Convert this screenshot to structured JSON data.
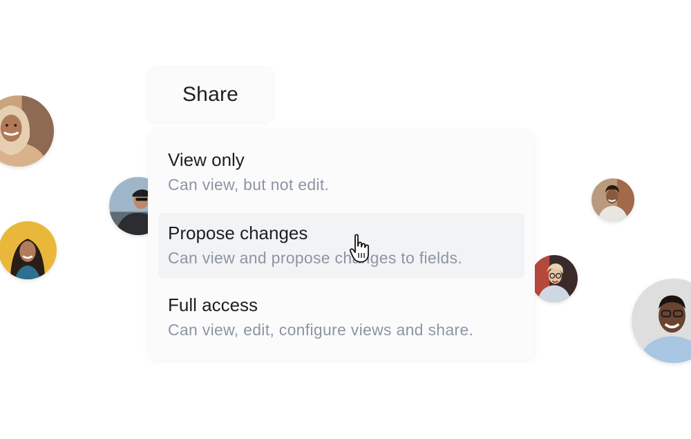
{
  "share": {
    "label": "Share"
  },
  "options": [
    {
      "title": "View only",
      "description": "Can view, but not edit."
    },
    {
      "title": "Propose changes",
      "description": "Can view and propose changes to fields."
    },
    {
      "title": "Full access",
      "description": "Can view, edit, configure views and share."
    }
  ],
  "hovered_option": "Propose changes",
  "cursor": {
    "icon": "hand-pointer-icon"
  },
  "avatars": [
    {
      "icon": "avatar-woman-headscarf"
    },
    {
      "icon": "avatar-cyclist"
    },
    {
      "icon": "avatar-woman-yellow-background"
    },
    {
      "icon": "avatar-man-curly-hair"
    },
    {
      "icon": "avatar-woman-glasses"
    },
    {
      "icon": "avatar-man-smiling-glasses"
    }
  ],
  "colors": {
    "title_text": "#1d1f25",
    "description_text": "#8c95a3",
    "panel_background": "#fbfbfc",
    "hover_background": "#f2f3f5"
  }
}
